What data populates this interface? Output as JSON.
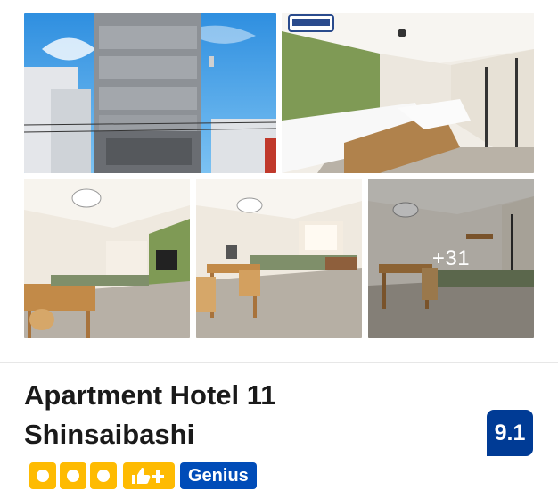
{
  "property": {
    "name": "Apartment Hotel 11 Shinsaibashi",
    "review_score": "9.1"
  },
  "gallery": {
    "more_photos_label": "+31",
    "photo_icons": [
      "building-exterior-photo",
      "bedroom-photo",
      "living-room-photo",
      "dining-area-photo",
      "lounge-photo"
    ]
  },
  "badges": {
    "star_rating": 3,
    "genius_label": "Genius",
    "colors": {
      "star": "#febb02",
      "genius": "#004cb8",
      "score": "#003b95"
    }
  }
}
